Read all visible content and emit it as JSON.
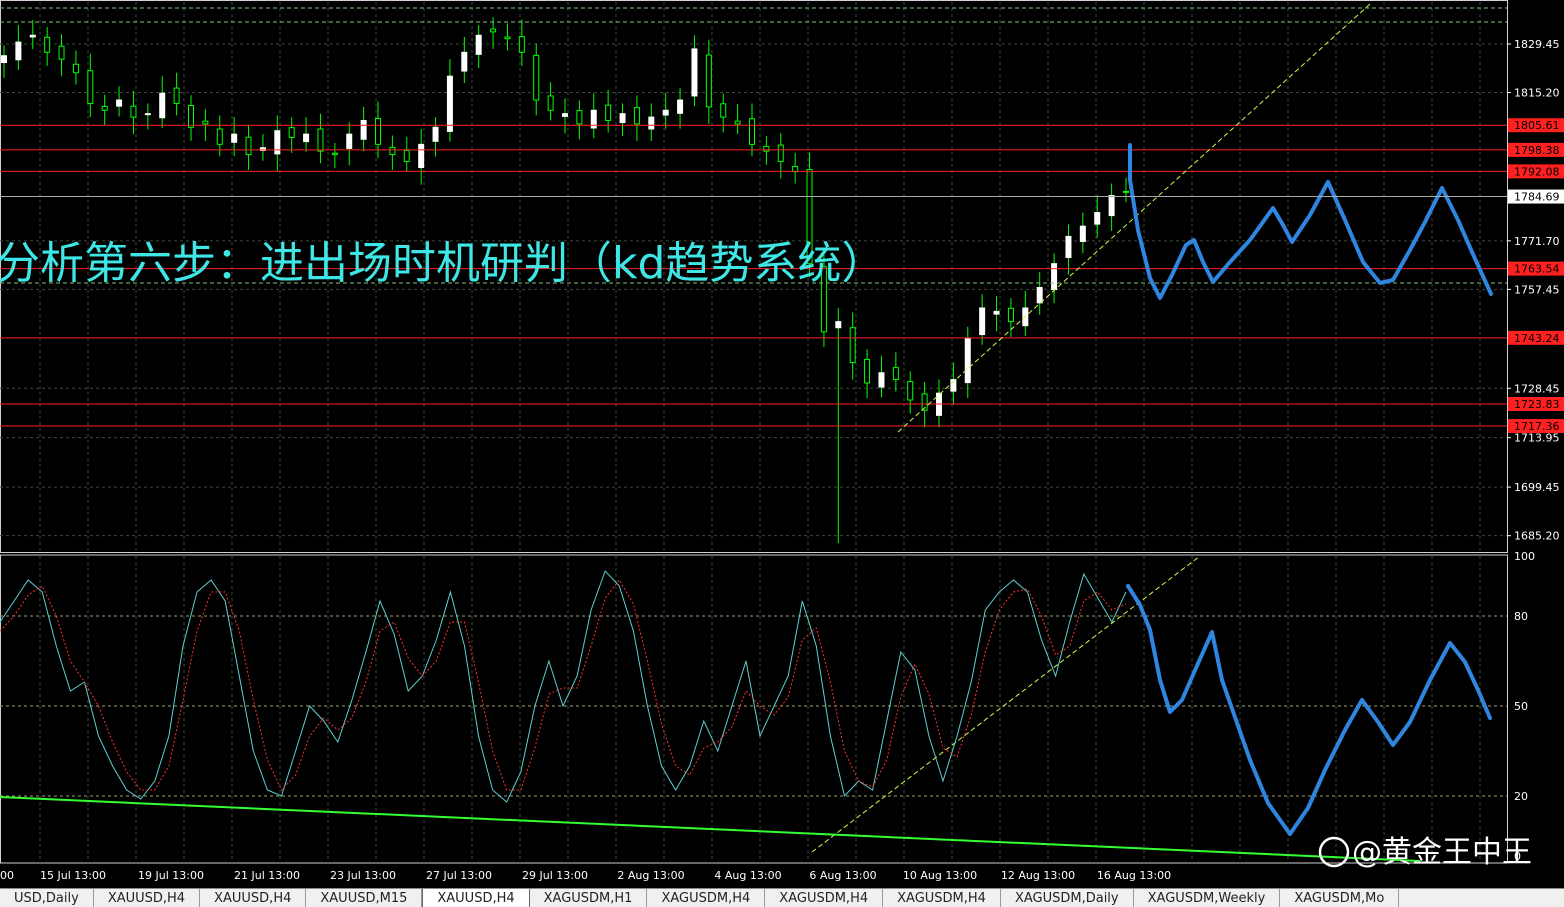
{
  "overlay_title": "分析第六步：进出场时机研判（kd趋势系统）",
  "watermark": "@黄金王中王",
  "colors": {
    "background": "#000000",
    "grid": "#3c4a3c",
    "candle_up_body": "#ffffff",
    "candle_wick": "#00ff00",
    "candle_down_body": "#00ff00",
    "hline": "#ff2020",
    "hline_tag_bg": "#ff2020",
    "trend_dash": "#c8ff50",
    "stoch_main": "#5fd0d0",
    "stoch_signal": "#ff3030",
    "long_trend": "#33ff33",
    "forecast": "#2f86e0",
    "overlay_text": "#3fe6e6"
  },
  "tabs": [
    {
      "label": "USD,Daily",
      "active": false
    },
    {
      "label": "XAUUSD,H4",
      "active": false
    },
    {
      "label": "XAUUSD,H4",
      "active": false
    },
    {
      "label": "XAUUSD,M15",
      "active": false
    },
    {
      "label": "XAUUSD,H4",
      "active": true
    },
    {
      "label": "XAGUSDM,H1",
      "active": false
    },
    {
      "label": "XAGUSDM,H4",
      "active": false
    },
    {
      "label": "XAGUSDM,H4",
      "active": false
    },
    {
      "label": "XAGUSDM,H4",
      "active": false
    },
    {
      "label": "XAGUSDM,Daily",
      "active": false
    },
    {
      "label": "XAGUSDM,Weekly",
      "active": false
    },
    {
      "label": "XAGUSDM,Mo",
      "active": false
    }
  ],
  "chart_data": [
    {
      "type": "candlestick",
      "symbol": "XAUUSD,H4",
      "price_axis_labels": [
        "1829.45",
        "1815.20",
        "1771.70",
        "1757.45",
        "1728.45",
        "1713.95",
        "1699.45",
        "1685.20"
      ],
      "ylim": [
        1681,
        1840
      ],
      "current_price": "1784.69",
      "horizontal_levels": [
        "1805.61",
        "1798.38",
        "1792.08",
        "1763.54",
        "1743.24",
        "1723.83",
        "1717.36"
      ],
      "time_labels": [
        "00",
        "15 Jul 13:00",
        "19 Jul 13:00",
        "21 Jul 13:00",
        "23 Jul 13:00",
        "27 Jul 13:00",
        "29 Jul 13:00",
        "2 Aug 13:00",
        "4 Aug 13:00",
        "6 Aug 13:00",
        "10 Aug 13:00",
        "12 Aug 13:00",
        "16 Aug 13:00"
      ],
      "close_path": [
        1826,
        1830,
        1832,
        1827,
        1825,
        1821,
        1812,
        1810,
        1813,
        1808,
        1809,
        1815,
        1812,
        1805,
        1806,
        1800,
        1803,
        1797,
        1799,
        1804,
        1802,
        1803,
        1798,
        1797,
        1803,
        1807,
        1800,
        1797,
        1795,
        1800,
        1805,
        1820,
        1827,
        1832,
        1833,
        1831,
        1827,
        1813,
        1810,
        1809,
        1806,
        1810,
        1807,
        1809,
        1806,
        1808,
        1810,
        1813,
        1828,
        1811,
        1808,
        1806,
        1800,
        1798,
        1795,
        1792,
        1765,
        1745,
        1748,
        1736,
        1730,
        1733,
        1731,
        1725,
        1722,
        1727,
        1731,
        1743,
        1752,
        1751,
        1748,
        1752,
        1758,
        1765,
        1773,
        1776,
        1780,
        1785,
        1786
      ]
    },
    {
      "type": "line",
      "name": "Stochastic Oscillator",
      "ylim": [
        0,
        100
      ],
      "y_axis_labels": [
        "100",
        "80",
        "50",
        "20",
        "0"
      ],
      "series": [
        {
          "values": [
            78,
            85,
            92,
            88,
            70,
            55,
            58,
            40,
            30,
            22,
            19,
            25,
            40,
            70,
            88,
            92,
            85,
            60,
            35,
            22,
            20,
            35,
            50,
            45,
            38,
            52,
            68,
            85,
            74,
            55,
            60,
            72,
            88,
            70,
            40,
            22,
            18,
            28,
            50,
            65,
            50,
            60,
            82,
            95,
            90,
            75,
            50,
            30,
            22,
            30,
            45,
            35,
            50,
            65,
            40,
            50,
            60,
            85,
            70,
            40,
            20,
            25,
            22,
            45,
            68,
            62,
            40,
            25,
            40,
            58,
            82,
            88,
            92,
            88,
            72,
            60,
            78,
            94,
            86,
            78,
            88
          ]
        },
        {
          "values": [
            75,
            80,
            87,
            90,
            80,
            65,
            58,
            50,
            38,
            28,
            22,
            22,
            30,
            52,
            75,
            88,
            88,
            75,
            52,
            32,
            22,
            27,
            40,
            46,
            42,
            46,
            58,
            75,
            78,
            66,
            60,
            65,
            78,
            78,
            58,
            35,
            22,
            22,
            36,
            54,
            56,
            56,
            70,
            86,
            92,
            84,
            65,
            44,
            30,
            27,
            36,
            38,
            43,
            55,
            50,
            47,
            53,
            72,
            76,
            58,
            35,
            25,
            23,
            32,
            53,
            64,
            54,
            36,
            33,
            47,
            68,
            82,
            88,
            89,
            80,
            67,
            70,
            85,
            88,
            82,
            84
          ]
        }
      ]
    }
  ]
}
